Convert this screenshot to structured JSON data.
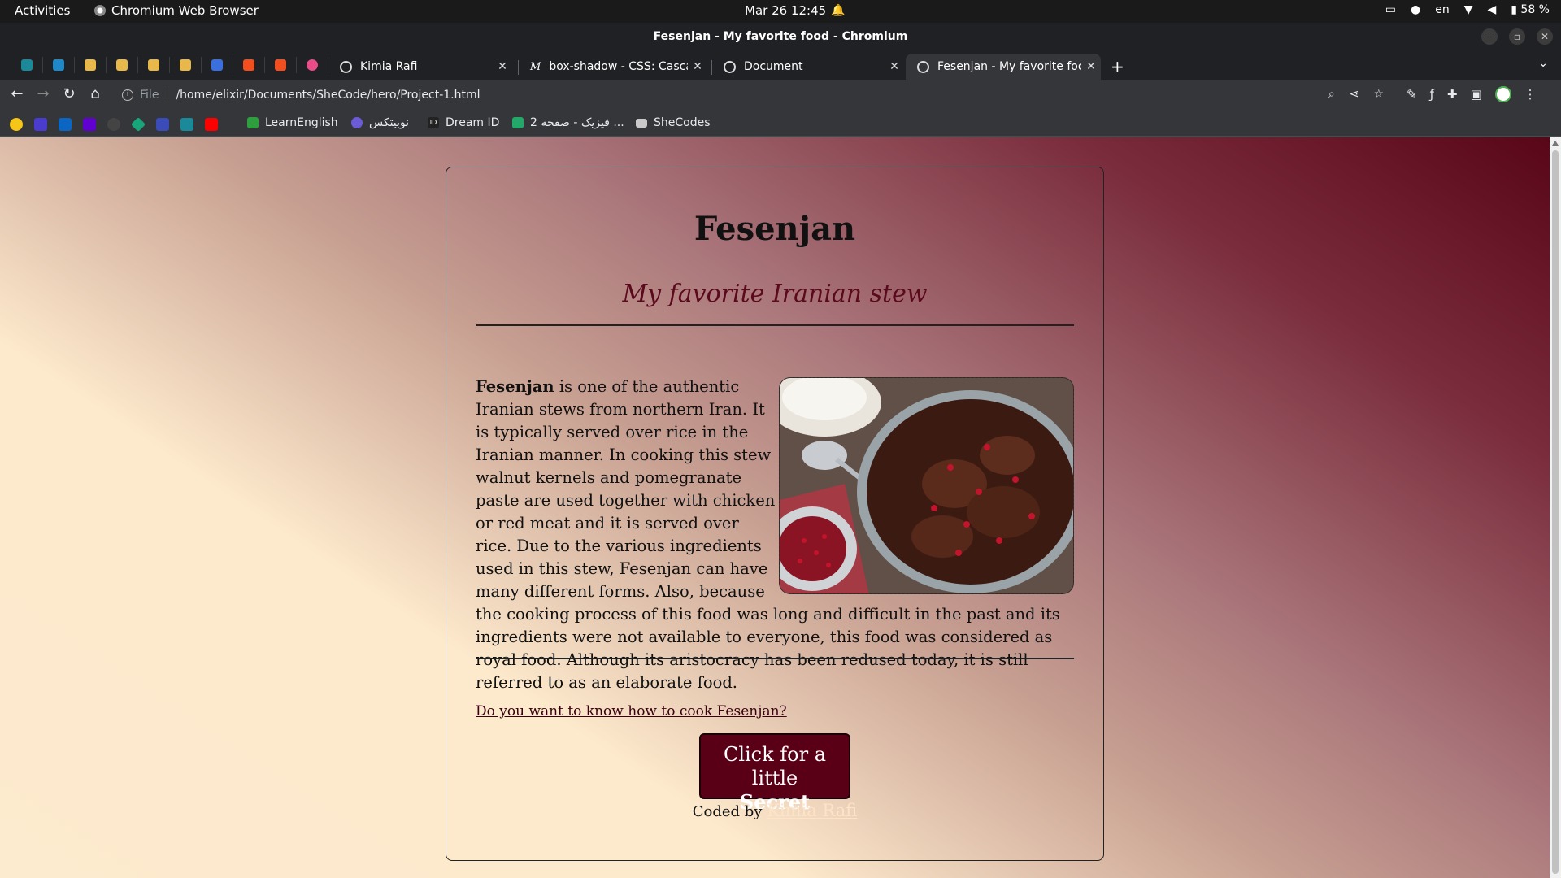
{
  "system": {
    "activities": "Activities",
    "app_name": "Chromium Web Browser",
    "clock": "Mar 26  12:45",
    "lang": "en",
    "battery": "58 %"
  },
  "window": {
    "title": "Fesenjan - My favorite food - Chromium"
  },
  "tabs": [
    {
      "label": "Kimia Rafi",
      "active": false
    },
    {
      "label": "box-shadow - CSS: Cascad",
      "active": false
    },
    {
      "label": "Document",
      "active": false
    },
    {
      "label": "Fesenjan - My favorite foo",
      "active": true
    }
  ],
  "address_bar": {
    "scheme": "File",
    "url": "/home/elixir/Documents/SheCode/hero/Project-1.html"
  },
  "bookmarks": [
    {
      "label": "LearnEnglish"
    },
    {
      "label": "نوبیتکس"
    },
    {
      "label": "Dream ID"
    },
    {
      "label": "فیزیک - صفحه 2 ..."
    },
    {
      "label": "SheCodes"
    }
  ],
  "page": {
    "title": "Fesenjan",
    "subtitle": "My favorite Iranian stew",
    "lead_word": "Fesenjan",
    "body": " is one of the authentic Iranian stews from northern Iran. It is typically served over rice in the Iranian manner. In cooking this stew walnut kernels and pomegranate paste are used together with chicken or red meat and it is served over rice. Due to the various ingredients used in this stew, Fesenjan can have many different forms. Also, because the cooking process of this food was long and difficult in the past and its ingredients were not available to everyone, this food was considered as royal food. Although its aristocracy has been redused today, it is still referred to as an elaborate food.",
    "link": "Do you want to know how to cook Fesenjan?",
    "button_line1": "Click for a little",
    "button_line2": "Secret",
    "credit_prefix": "Coded by",
    "credit_name": "Kimia Rafi"
  },
  "colors": {
    "accent": "#5a0016",
    "subtitle": "#5a0a1c",
    "bg_light": "#fdebcf",
    "bg_dark": "#580618"
  }
}
